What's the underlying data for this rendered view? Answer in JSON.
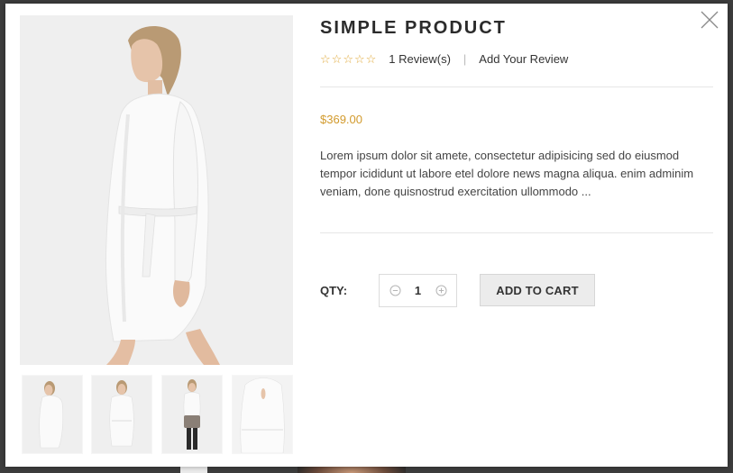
{
  "product": {
    "title": "SIMPLE PRODUCT",
    "rating_stars": 5,
    "rating_value": 0,
    "reviews_link": "1 Review(s)",
    "separator": "|",
    "add_review": "Add Your Review",
    "price": "$369.00",
    "description": "Lorem ipsum dolor sit amete, consectetur adipisicing sed do eiusmod tempor icididunt ut labore etel dolore news magna aliqua. enim adminim veniam, done quisnostrud exercitation ullommodo ..."
  },
  "purchase": {
    "qty_label": "QTY:",
    "qty_value": "1",
    "add_to_cart": "ADD TO CART"
  },
  "gallery": {
    "thumbnails": [
      "dress-side-view",
      "dress-front-view",
      "dress-with-bag",
      "dress-back-view"
    ]
  },
  "colors": {
    "price": "#d29a2c",
    "stars": "#e0a93a",
    "button_bg": "#ececec"
  },
  "icons": [
    "close-icon",
    "star-outline-icon",
    "minus-circle-icon",
    "plus-circle-icon"
  ]
}
